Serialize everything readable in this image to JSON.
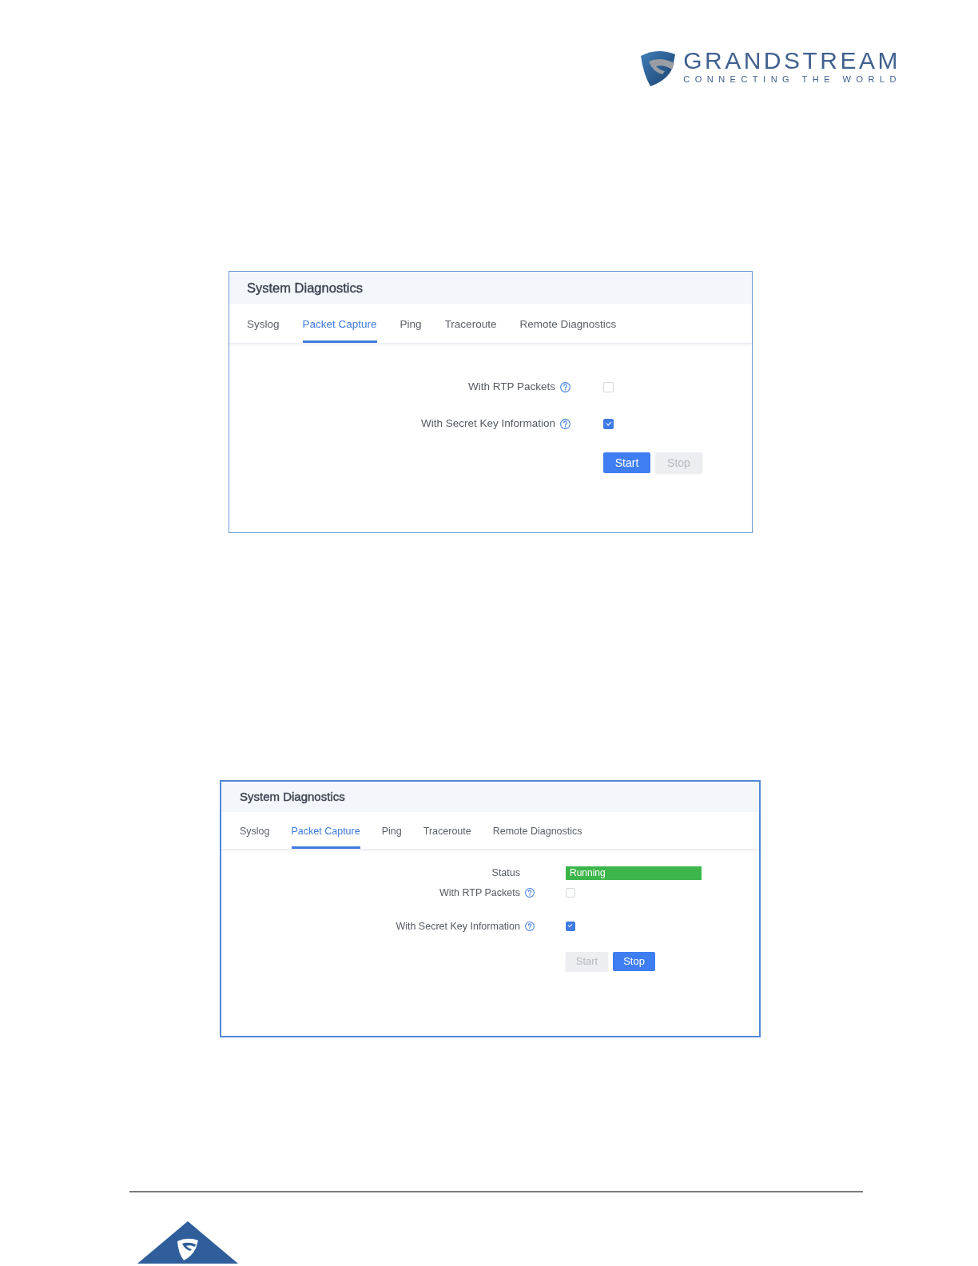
{
  "logo": {
    "wordmark": "GRANDSTREAM",
    "tagline": "CONNECTING THE WORLD"
  },
  "panels": [
    {
      "title": "System Diagnostics",
      "tabs": [
        {
          "label": "Syslog",
          "selected": false
        },
        {
          "label": "Packet Capture",
          "selected": true
        },
        {
          "label": "Ping",
          "selected": false
        },
        {
          "label": "Traceroute",
          "selected": false
        },
        {
          "label": "Remote Diagnostics",
          "selected": false
        }
      ],
      "fields": [
        {
          "kind": "checkbox",
          "label": "With RTP Packets",
          "checked": false
        },
        {
          "kind": "checkbox",
          "label": "With Secret Key Information",
          "checked": true
        }
      ],
      "buttons": [
        {
          "label": "Start",
          "disabled": false
        },
        {
          "label": "Stop",
          "disabled": true
        }
      ]
    },
    {
      "title": "System Diagnostics",
      "tabs": [
        {
          "label": "Syslog",
          "selected": false
        },
        {
          "label": "Packet Capture",
          "selected": true
        },
        {
          "label": "Ping",
          "selected": false
        },
        {
          "label": "Traceroute",
          "selected": false
        },
        {
          "label": "Remote Diagnostics",
          "selected": false
        }
      ],
      "fields": [
        {
          "kind": "status",
          "label": "Status",
          "value": "Running"
        },
        {
          "kind": "checkbox",
          "label": "With RTP Packets",
          "checked": false
        },
        {
          "kind": "checkbox",
          "label": "With Secret Key Information",
          "checked": true
        }
      ],
      "buttons": [
        {
          "label": "Start",
          "disabled": true
        },
        {
          "label": "Stop",
          "disabled": false
        }
      ]
    }
  ]
}
